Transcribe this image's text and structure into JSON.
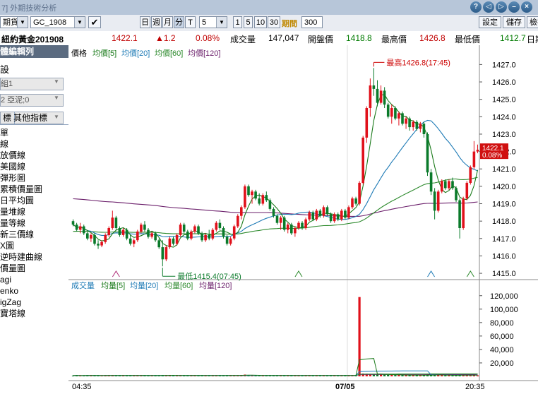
{
  "window": {
    "title": "7] 外期技術分析"
  },
  "toolbar": {
    "market": "期貨",
    "symbol": "GC_1908",
    "period_buttons": [
      "日",
      "週",
      "月",
      "分",
      "T"
    ],
    "minute_value": "5",
    "quick_minutes": [
      "1",
      "5",
      "10",
      "30"
    ],
    "period_label": "期間",
    "period_value": "300",
    "settings_label": "設定",
    "save_label": "儲存",
    "view_label": "檢視"
  },
  "quote": {
    "name": "紐約黃金201908",
    "price": "1422.1",
    "change": "▲1.2",
    "change_pct": "0.08%",
    "volume_label": "成交量",
    "volume": "147,047",
    "open_label": "開盤價",
    "open": "1418.8",
    "high_label": "最高價",
    "high": "1426.8",
    "low_label": "最低價",
    "low": "1412.7",
    "date_label": "日期"
  },
  "left_panel": {
    "header": "體編輯列",
    "section": "設",
    "combo1": "組1",
    "combo2": "2 亞泥;0",
    "tab1": "標",
    "tab2": "其他指標",
    "indicators": [
      "單",
      "線",
      "放價線",
      "美國線",
      "彈形圖",
      "累積價量圖",
      "日平均圖",
      "量堆線",
      "量等線",
      "新三價線",
      "X圖",
      "逆時建曲線",
      "價量圖",
      "agi",
      "enko",
      "igZag",
      "寶塔線"
    ]
  },
  "colors": {
    "up": "#e0101a",
    "down": "#0a7a2a",
    "ma5": "#1a7a1a",
    "ma20": "#1f7bb6",
    "ma60": "#2d8a2d",
    "ma120": "#6b1f6b",
    "accent": "#cc0000"
  },
  "price_chart": {
    "legend": {
      "price": "價格",
      "ma5": "均價[5]",
      "ma20": "均價[20]",
      "ma60": "均價[60]",
      "ma120": "均價[120]"
    },
    "high_note": "最高1426.8(17:45)",
    "low_note": "最低1415.4(07:45)",
    "price_tag": "1422.1",
    "pct_tag": "0.08%"
  },
  "volume_chart": {
    "legend": {
      "vol": "成交量",
      "ma5": "均量[5]",
      "ma20": "均量[20]",
      "ma60": "均量[60]",
      "ma120": "均量[120]"
    }
  },
  "x_labels": [
    "04:35",
    "07/05",
    "20:35"
  ],
  "chart_data": {
    "type": "candlestick",
    "price_axis": {
      "ylim": [
        1414.8,
        1427.3
      ],
      "ticks": [
        1415.0,
        1416.0,
        1417.0,
        1418.0,
        1419.0,
        1420.0,
        1421.0,
        1422.0,
        1423.0,
        1424.0,
        1425.0,
        1426.0,
        1427.0
      ]
    },
    "volume_axis": {
      "ylim": [
        0,
        125000
      ],
      "ticks": [
        20000,
        40000,
        60000,
        80000,
        100000,
        120000
      ],
      "tick_labels": [
        "20,000",
        "40,000",
        "60,000",
        "80,000",
        "100,000",
        "120,000"
      ]
    },
    "candles": [
      [
        1418.0,
        1418.1,
        1417.7,
        1417.8
      ],
      [
        1417.8,
        1417.9,
        1417.4,
        1417.5
      ],
      [
        1417.5,
        1417.9,
        1417.3,
        1417.7
      ],
      [
        1417.7,
        1417.8,
        1417.2,
        1417.3
      ],
      [
        1417.3,
        1417.4,
        1416.9,
        1417.0
      ],
      [
        1417.0,
        1417.3,
        1416.8,
        1417.2
      ],
      [
        1417.2,
        1417.3,
        1416.6,
        1416.7
      ],
      [
        1416.7,
        1416.9,
        1416.4,
        1416.6
      ],
      [
        1416.6,
        1416.9,
        1416.5,
        1416.8
      ],
      [
        1416.8,
        1417.3,
        1416.7,
        1417.2
      ],
      [
        1417.2,
        1417.7,
        1417.1,
        1417.6
      ],
      [
        1417.6,
        1418.6,
        1417.5,
        1418.2
      ],
      [
        1418.2,
        1418.3,
        1417.5,
        1417.6
      ],
      [
        1417.6,
        1417.7,
        1417.1,
        1417.2
      ],
      [
        1417.2,
        1417.6,
        1417.1,
        1417.5
      ],
      [
        1417.5,
        1417.6,
        1416.9,
        1417.0
      ],
      [
        1417.0,
        1417.2,
        1416.6,
        1416.7
      ],
      [
        1416.7,
        1417.0,
        1416.5,
        1416.9
      ],
      [
        1416.9,
        1417.5,
        1416.8,
        1417.4
      ],
      [
        1417.4,
        1417.9,
        1417.3,
        1417.8
      ],
      [
        1417.8,
        1418.0,
        1417.4,
        1417.5
      ],
      [
        1417.5,
        1417.6,
        1417.0,
        1417.1
      ],
      [
        1417.1,
        1417.4,
        1417.0,
        1417.3
      ],
      [
        1417.3,
        1417.4,
        1416.8,
        1416.9
      ],
      [
        1416.9,
        1417.0,
        1416.4,
        1416.5
      ],
      [
        1416.5,
        1416.9,
        1415.4,
        1415.8
      ],
      [
        1415.8,
        1416.6,
        1415.7,
        1416.5
      ],
      [
        1416.5,
        1417.1,
        1416.4,
        1417.0
      ],
      [
        1417.0,
        1417.1,
        1416.6,
        1416.7
      ],
      [
        1416.7,
        1417.3,
        1416.6,
        1417.2
      ],
      [
        1417.2,
        1417.9,
        1417.1,
        1417.8
      ],
      [
        1417.8,
        1417.9,
        1417.3,
        1417.4
      ],
      [
        1417.4,
        1417.5,
        1416.9,
        1417.0
      ],
      [
        1417.0,
        1417.5,
        1416.9,
        1417.4
      ],
      [
        1417.4,
        1417.8,
        1417.3,
        1417.7
      ],
      [
        1417.7,
        1417.8,
        1417.2,
        1417.3
      ],
      [
        1417.3,
        1417.4,
        1416.8,
        1416.9
      ],
      [
        1416.9,
        1417.3,
        1416.8,
        1417.2
      ],
      [
        1417.2,
        1417.5,
        1416.9,
        1417.0
      ],
      [
        1417.0,
        1417.6,
        1416.9,
        1417.5
      ],
      [
        1417.5,
        1418.0,
        1417.4,
        1417.9
      ],
      [
        1417.9,
        1418.1,
        1417.5,
        1417.6
      ],
      [
        1417.6,
        1417.7,
        1417.0,
        1417.1
      ],
      [
        1417.1,
        1417.2,
        1416.6,
        1416.7
      ],
      [
        1416.7,
        1417.1,
        1416.6,
        1417.0
      ],
      [
        1417.0,
        1417.8,
        1416.9,
        1417.7
      ],
      [
        1417.7,
        1418.4,
        1417.6,
        1418.3
      ],
      [
        1418.3,
        1418.9,
        1418.1,
        1418.8
      ],
      [
        1418.8,
        1420.1,
        1418.7,
        1420.0
      ],
      [
        1420.0,
        1420.1,
        1419.4,
        1419.5
      ],
      [
        1419.5,
        1419.8,
        1419.0,
        1419.7
      ],
      [
        1419.7,
        1419.8,
        1419.2,
        1419.3
      ],
      [
        1419.3,
        1419.6,
        1418.9,
        1419.0
      ],
      [
        1419.0,
        1419.6,
        1418.9,
        1419.5
      ],
      [
        1419.5,
        1419.7,
        1419.1,
        1419.2
      ],
      [
        1419.2,
        1419.3,
        1418.6,
        1418.7
      ],
      [
        1418.7,
        1418.8,
        1418.2,
        1418.3
      ],
      [
        1418.3,
        1418.4,
        1417.8,
        1417.9
      ],
      [
        1417.9,
        1418.3,
        1417.5,
        1418.2
      ],
      [
        1418.2,
        1418.3,
        1417.4,
        1417.5
      ],
      [
        1417.5,
        1417.9,
        1417.3,
        1417.8
      ],
      [
        1417.8,
        1417.9,
        1417.2,
        1417.3
      ],
      [
        1417.3,
        1417.7,
        1417.1,
        1417.6
      ],
      [
        1417.6,
        1418.0,
        1417.5,
        1417.9
      ],
      [
        1417.9,
        1418.0,
        1417.5,
        1417.6
      ],
      [
        1417.6,
        1418.2,
        1417.5,
        1418.1
      ],
      [
        1418.1,
        1418.6,
        1418.0,
        1418.5
      ],
      [
        1418.5,
        1418.6,
        1418.0,
        1418.1
      ],
      [
        1418.1,
        1418.7,
        1418.0,
        1418.6
      ],
      [
        1418.6,
        1418.7,
        1418.2,
        1418.3
      ],
      [
        1418.3,
        1418.9,
        1418.2,
        1418.8
      ],
      [
        1418.8,
        1418.9,
        1418.3,
        1418.4
      ],
      [
        1418.4,
        1418.5,
        1417.9,
        1418.0
      ],
      [
        1418.0,
        1418.5,
        1417.9,
        1418.4
      ],
      [
        1418.4,
        1418.5,
        1418.0,
        1418.1
      ],
      [
        1418.1,
        1418.7,
        1418.0,
        1418.6
      ],
      [
        1418.6,
        1418.7,
        1418.1,
        1418.2
      ],
      [
        1418.2,
        1418.9,
        1418.1,
        1418.8
      ],
      [
        1418.8,
        1419.4,
        1418.7,
        1419.3
      ],
      [
        1419.3,
        1419.4,
        1418.9,
        1419.0
      ],
      [
        1419.0,
        1420.3,
        1418.9,
        1420.2
      ],
      [
        1420.2,
        1422.9,
        1420.1,
        1422.8
      ],
      [
        1422.8,
        1424.6,
        1422.5,
        1424.5
      ],
      [
        1424.5,
        1426.2,
        1424.0,
        1425.8
      ],
      [
        1425.8,
        1426.8,
        1425.2,
        1425.6
      ],
      [
        1425.6,
        1426.1,
        1424.6,
        1424.8
      ],
      [
        1424.8,
        1425.8,
        1424.7,
        1425.5
      ],
      [
        1425.5,
        1425.7,
        1424.5,
        1424.7
      ],
      [
        1424.7,
        1424.8,
        1423.9,
        1424.0
      ],
      [
        1424.0,
        1424.7,
        1423.6,
        1424.5
      ],
      [
        1424.5,
        1424.6,
        1423.8,
        1423.9
      ],
      [
        1423.9,
        1424.3,
        1423.5,
        1424.2
      ],
      [
        1424.2,
        1424.3,
        1423.5,
        1423.6
      ],
      [
        1423.6,
        1424.0,
        1423.3,
        1423.9
      ],
      [
        1423.9,
        1424.0,
        1423.2,
        1423.4
      ],
      [
        1423.4,
        1423.8,
        1423.2,
        1423.7
      ],
      [
        1423.7,
        1423.8,
        1423.2,
        1423.3
      ],
      [
        1423.3,
        1423.7,
        1423.1,
        1423.6
      ],
      [
        1423.6,
        1423.7,
        1422.8,
        1423.0
      ],
      [
        1423.0,
        1423.1,
        1420.6,
        1420.8
      ],
      [
        1420.8,
        1421.0,
        1419.5,
        1419.7
      ],
      [
        1419.7,
        1419.9,
        1418.1,
        1418.6
      ],
      [
        1418.6,
        1419.8,
        1418.5,
        1419.7
      ],
      [
        1419.7,
        1420.4,
        1419.6,
        1420.3
      ],
      [
        1420.3,
        1420.4,
        1419.8,
        1419.9
      ],
      [
        1419.9,
        1420.4,
        1419.8,
        1420.3
      ],
      [
        1420.3,
        1420.5,
        1419.8,
        1419.9
      ],
      [
        1419.9,
        1420.0,
        1419.1,
        1419.2
      ],
      [
        1419.2,
        1419.3,
        1417.0,
        1417.6
      ],
      [
        1417.6,
        1419.4,
        1417.5,
        1419.3
      ],
      [
        1419.3,
        1420.3,
        1419.2,
        1420.2
      ],
      [
        1420.2,
        1421.2,
        1420.1,
        1421.1
      ],
      [
        1421.1,
        1422.6,
        1421.0,
        1422.0
      ],
      [
        1422.0,
        1422.4,
        1421.9,
        1422.1
      ]
    ],
    "volume": [
      1200,
      1300,
      1100,
      1200,
      1400,
      1100,
      1300,
      1200,
      1000,
      1300,
      1500,
      1700,
      1200,
      1100,
      1200,
      1300,
      1400,
      1100,
      1200,
      1300,
      1100,
      1200,
      1000,
      1300,
      1400,
      2100,
      1600,
      1400,
      1200,
      1300,
      1500,
      1100,
      1200,
      1300,
      1100,
      1200,
      1300,
      1100,
      1000,
      1200,
      1300,
      1200,
      1100,
      1300,
      1200,
      1400,
      1600,
      1800,
      2600,
      1500,
      1300,
      1200,
      1300,
      1100,
      1200,
      1300,
      1400,
      1300,
      1200,
      1300,
      1100,
      1200,
      1300,
      1100,
      1200,
      1300,
      1400,
      1100,
      1200,
      1300,
      1200,
      1100,
      1300,
      1200,
      1100,
      1200,
      1300,
      1100,
      1400,
      1600,
      118000,
      4200,
      3900,
      3600,
      3300,
      3100,
      2800,
      2600,
      2400,
      2200,
      2000,
      2100,
      1900,
      1800,
      1700,
      1600,
      1700,
      1500,
      1800,
      2300,
      2000,
      2400,
      1900,
      1700,
      1500,
      1600,
      1500,
      1400,
      2300,
      1900,
      1800,
      1700,
      1900,
      1500
    ]
  }
}
